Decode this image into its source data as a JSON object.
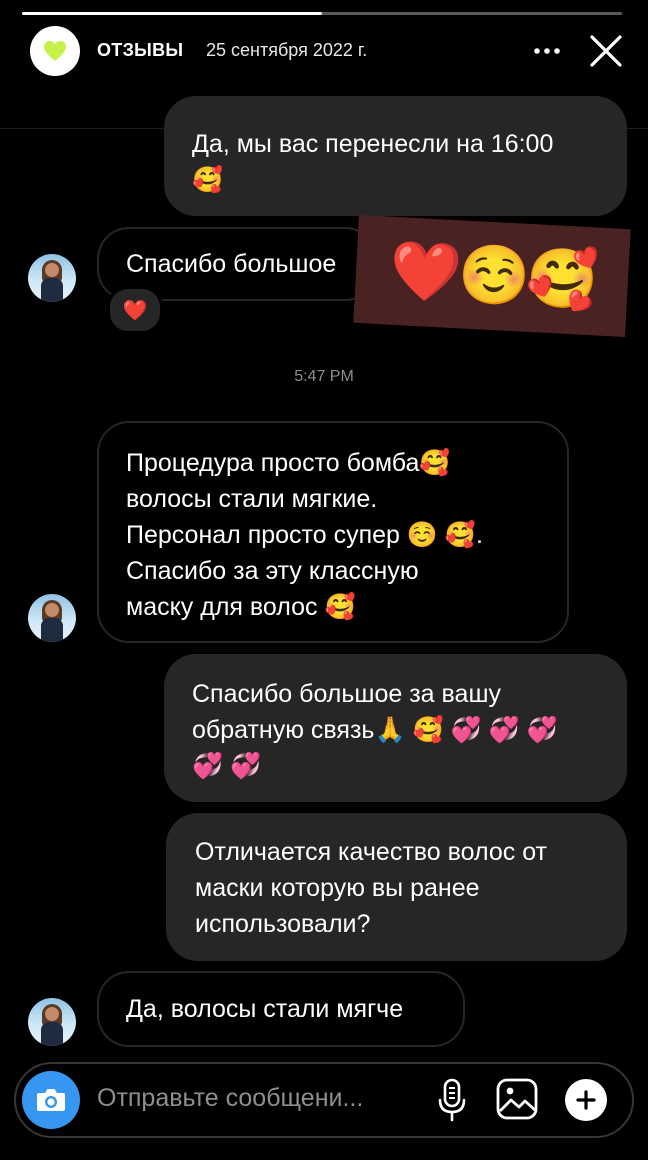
{
  "story": {
    "progress": 0.5
  },
  "header": {
    "title": "ОТЗЫВЫ",
    "date": "25 сентября 2022 г.",
    "more_icon": "more-horizontal-icon",
    "close_icon": "close-icon"
  },
  "messages": [
    {
      "direction": "outgoing",
      "text": "Да, мы вас перенесли на 16:00\n🥰"
    },
    {
      "direction": "incoming",
      "text": "Спасибо большое",
      "reaction": "❤️"
    },
    {
      "direction": "incoming",
      "text": "Процедура просто бомба🥰\nволосы стали мягкие.\nПерсонал просто супер ☺️ 🥰.\nСпасибо за эту классную\nмаску для волос 🥰"
    },
    {
      "direction": "outgoing",
      "text": "Спасибо большое за вашу\nобратную связь🙏 🥰 💞 💞 💞\n💞 💞"
    },
    {
      "direction": "outgoing",
      "text": "Отличается качество волос от\nмаски которую вы ранее\nиспользовали?"
    },
    {
      "direction": "incoming",
      "text": "Да, волосы стали мягче"
    }
  ],
  "sticker": {
    "emojis": "❤️☺️🥰"
  },
  "timestamp": "5:47 PM",
  "composer": {
    "placeholder": "Отправьте сообщени...",
    "camera_icon": "camera-icon",
    "mic_icon": "microphone-icon",
    "gallery_icon": "gallery-icon",
    "plus_icon": "plus-icon"
  },
  "colors": {
    "bubble_out": "#262626",
    "accent": "#3797f0",
    "logo_heart": "#c6f04a"
  }
}
